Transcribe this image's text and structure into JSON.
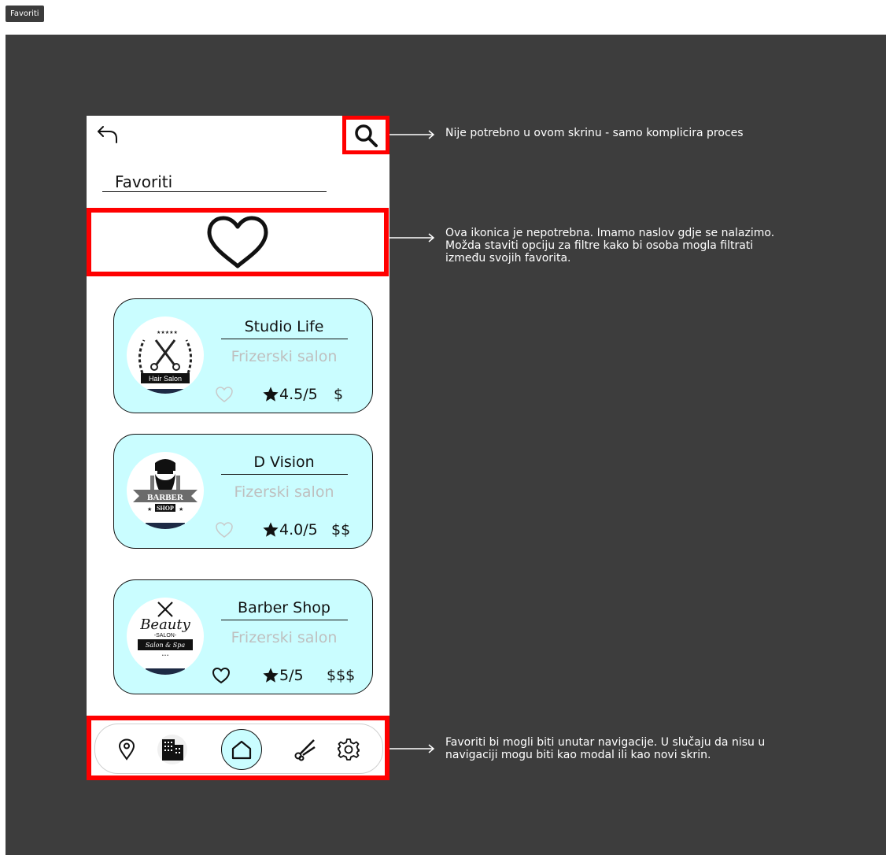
{
  "frame": {
    "label": "Favoriti"
  },
  "header": {
    "title": "Favoriti"
  },
  "salons": [
    {
      "name": "Studio Life",
      "type": "Frizerski salon",
      "rating": "4.5/5",
      "price": "$",
      "logo_text": "Hair Salon"
    },
    {
      "name": "D Vision",
      "type": "Fizerski salon",
      "rating": "4.0/5",
      "price": "$$",
      "logo_text": "BARBER SHOP"
    },
    {
      "name": "Barber Shop",
      "type": "Frizerski salon",
      "rating": "5/5",
      "price": "$$$",
      "logo_text": "Beauty -SALON- Salon & Spa"
    }
  ],
  "nav": {
    "items": [
      "location-icon",
      "buildings-icon",
      "home-icon",
      "scissors-icon",
      "settings-icon"
    ],
    "active": "home-icon"
  },
  "annotations": [
    {
      "text": "Nije potrebno u ovom skrinu - samo komplicira proces"
    },
    {
      "lines": [
        "Ova ikonica je nepotrebna. Imamo naslov gdje se nalazimo.",
        "Možda staviti opciju za filtre kako bi osoba mogla filtrati",
        "između svojih favorita."
      ]
    },
    {
      "lines": [
        "Favoriti bi mogli biti unutar navigacije. U slučaju da nisu u",
        "navigaciji mogu biti kao modal ili kao novi skrin."
      ]
    }
  ],
  "colors": {
    "card_bg": "#cafdff",
    "highlight": "#ff0000",
    "canvas": "#3d3d3d"
  }
}
